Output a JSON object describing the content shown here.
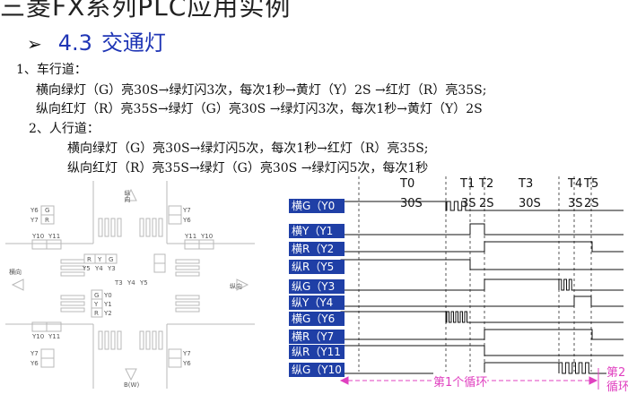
{
  "header": {
    "title": "三菱FX系列PLC应用实例"
  },
  "section": {
    "bullet": "➢",
    "number": "4.3",
    "title": "交通灯"
  },
  "text": {
    "vehicle_heading": "1、车行道：",
    "vehicle_h": "横向绿灯（G）亮30S→绿灯闪3次，每次1秒→黄灯（Y）2S →红灯（R）亮35S;",
    "vehicle_v": "纵向红灯（R）亮35S→绿灯（G）亮30S →绿灯闪3次，每次1秒→黄灯（Y）2S",
    "ped_heading": "2、人行道：",
    "ped_h": "横向绿灯（G）亮30S→绿灯闪5次，每次1秒→红灯（R）亮35S;",
    "ped_v": "纵向红灯（R）亮35S→绿灯（G）亮30S →绿灯闪5次，每次1秒"
  },
  "diagram": {
    "north_label": "纵向",
    "south_label": "纵向",
    "east_label": "横向",
    "west_label": "横向",
    "south_bottom": "B(W)",
    "signals_nw": [
      "Y6",
      "Y7"
    ],
    "signals_nw_box": [
      "G",
      "R"
    ],
    "signals_nw2": [
      "Y10",
      "Y11"
    ],
    "signals_ne": [
      "Y7",
      "Y6"
    ],
    "signals_ne2": [
      "Y11",
      "Y10"
    ],
    "signals_center_top": [
      "R",
      "Y",
      "G"
    ],
    "signals_center_top_nums": [
      "Y5",
      "Y4",
      "Y3"
    ],
    "signals_center_mid": [
      "G",
      "Y",
      "R"
    ],
    "signals_center_mid_nums": [
      "Y0",
      "Y1",
      "Y2"
    ],
    "signals_center_mid2": [
      "T3",
      "Y4",
      "Y5"
    ],
    "signals_sw": [
      "Y10",
      "Y11"
    ],
    "signals_sw2": [
      "Y7",
      "Y6"
    ],
    "signals_se": [
      "Y7",
      "Y6"
    ]
  },
  "timing": {
    "channels": [
      "横G（Y0",
      "横Y（Y1",
      "横R（Y2",
      "纵R（Y5",
      "纵G（Y3",
      "纵Y（Y4",
      "横G（Y6",
      "横R（Y7",
      "纵R（Y11",
      "纵G（Y10"
    ],
    "markers": [
      {
        "name": "T0",
        "dur": "30S"
      },
      {
        "name": "T1",
        "dur": "3S"
      },
      {
        "name": "T2",
        "dur": "2S"
      },
      {
        "name": "T3",
        "dur": "30S"
      },
      {
        "name": "T4",
        "dur": "3S"
      },
      {
        "name": "T5",
        "dur": "2S"
      }
    ],
    "cycle1": "第1个循环",
    "cycle2": "第2",
    "cycle2_sub": "循环"
  }
}
